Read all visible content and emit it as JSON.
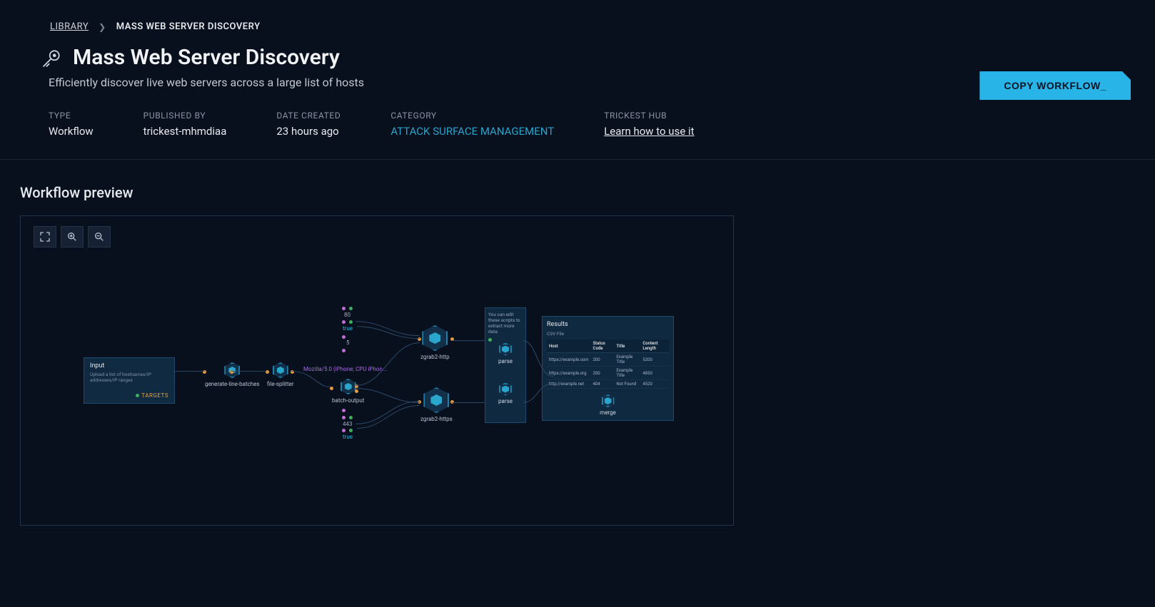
{
  "breadcrumb": {
    "root": "LIBRARY",
    "current": "MASS WEB SERVER DISCOVERY"
  },
  "page": {
    "title": "Mass Web Server Discovery",
    "subtitle": "Efficiently discover live web servers across a large list of hosts"
  },
  "meta": {
    "type_label": "TYPE",
    "type_value": "Workflow",
    "published_label": "PUBLISHED BY",
    "published_value": "trickest-mhmdiaa",
    "date_label": "DATE CREATED",
    "date_value": "23 hours ago",
    "category_label": "CATEGORY",
    "category_value": "ATTACK SURFACE MANAGEMENT",
    "hub_label": "TRICKEST HUB",
    "hub_value": "Learn how to use it"
  },
  "actions": {
    "copy_workflow": "COPY WORKFLOW_"
  },
  "section": {
    "preview_title": "Workflow preview"
  },
  "workflow": {
    "input_card": {
      "title": "Input",
      "description": "Upload a list of hostnames/IP addresses/IP ranges",
      "tag": "TARGETS"
    },
    "nodes": {
      "generate_line_batches": "generate-line-batches",
      "file_splitter": "file-splitter",
      "batch_output": "batch-output",
      "zgrab2_http": "zgrab2-http",
      "zgrab2_https": "zgrab2-https",
      "merge": "merge",
      "parse": "parse"
    },
    "params": {
      "port_http": "80",
      "port_https": "443",
      "true": "true",
      "count": "5",
      "ua": "Mozilla/5.0 (iPhone; CPU iPhon..."
    },
    "parse_card": {
      "note": "You can edit these scripts to extract more data"
    },
    "results": {
      "title": "Results",
      "subtitle": "CSV File",
      "headers": {
        "host": "Host",
        "status": "Status Code",
        "title": "Title",
        "clen": "Content Length"
      },
      "rows": [
        {
          "host": "https://example.com",
          "status": "200",
          "title": "Example Title",
          "clen": "5200"
        },
        {
          "host": "https://example.org",
          "status": "200",
          "title": "Example Title",
          "clen": "4850"
        },
        {
          "host": "http://example.net",
          "status": "404",
          "title": "Not Found",
          "clen": "4520"
        }
      ]
    }
  }
}
